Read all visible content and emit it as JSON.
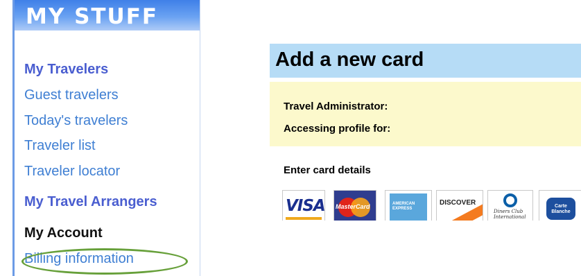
{
  "sidebar": {
    "header": "MY STUFF",
    "travelers_heading": "My Travelers",
    "traveler_links": [
      "Guest travelers",
      "Today's travelers",
      "Traveler list",
      "Traveler locator"
    ],
    "arrangers_heading": "My Travel Arrangers",
    "account_heading": "My Account",
    "billing_link": "Billing information"
  },
  "main": {
    "title": "Add a new card",
    "travel_admin_label": "Travel Administrator:",
    "accessing_label": "Accessing profile for:",
    "enter_details": "Enter card details"
  },
  "cards": {
    "visa": "VISA",
    "mastercard": "MasterCard",
    "amex": "AMERICAN EXPRESS",
    "discover": "DISCOVER",
    "diners": "Diners Club International",
    "carte_blanche": "Carte Blanche"
  },
  "colors": {
    "sidebar_header": "#4a86e8",
    "link": "#3f7fd3",
    "heading": "#4a5ed0",
    "title_bar": "#b6dcf6",
    "info_box": "#fcf9cc",
    "highlight_circle": "#67a03a"
  }
}
